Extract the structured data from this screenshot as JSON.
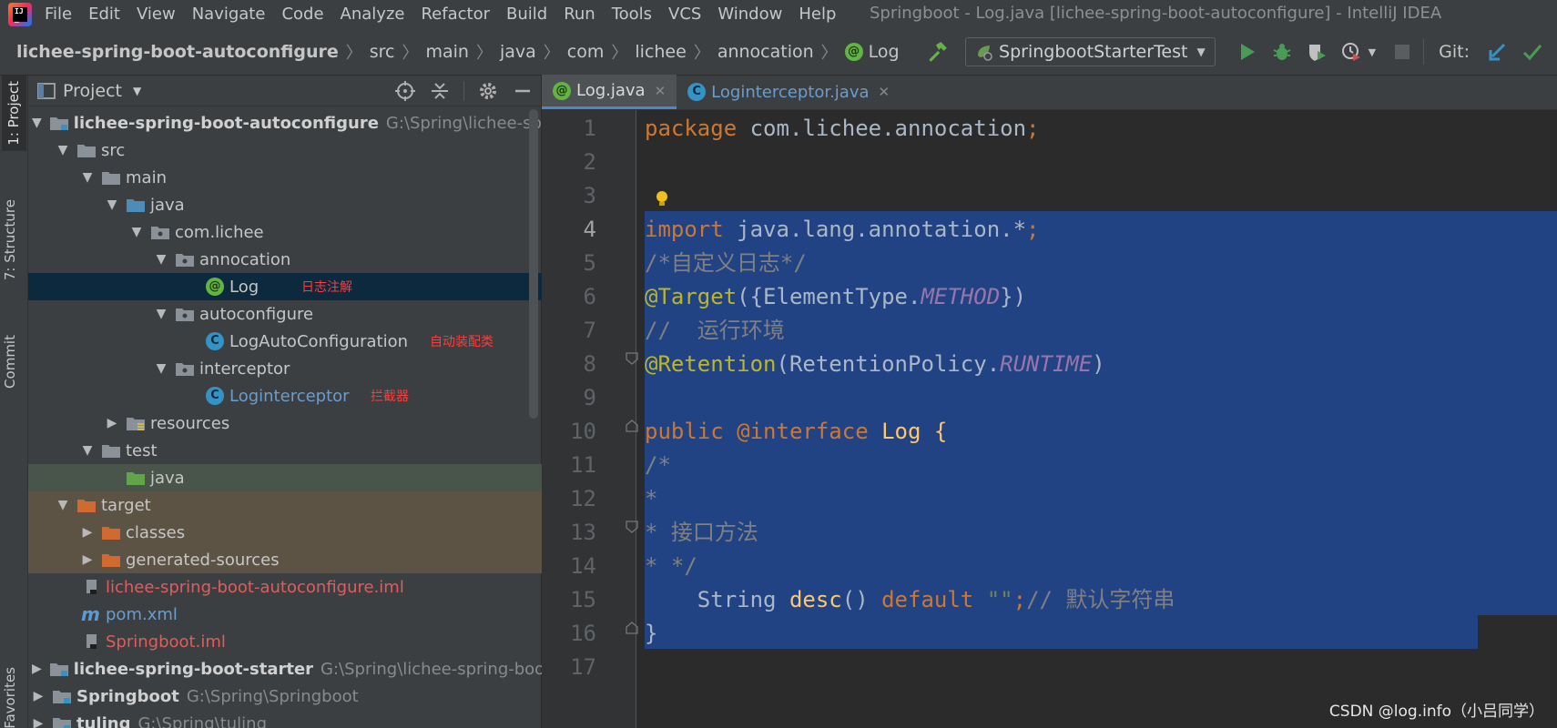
{
  "app": {
    "window_title": "Springboot - Log.java [lichee-spring-boot-autoconfigure] - IntelliJ IDEA",
    "logo": "intellij-logo"
  },
  "menu": {
    "items": [
      {
        "label": "File"
      },
      {
        "label": "Edit"
      },
      {
        "label": "View"
      },
      {
        "label": "Navigate"
      },
      {
        "label": "Code"
      },
      {
        "label": "Analyze"
      },
      {
        "label": "Refactor"
      },
      {
        "label": "Build"
      },
      {
        "label": "Run"
      },
      {
        "label": "Tools"
      },
      {
        "label": "VCS"
      },
      {
        "label": "Window"
      },
      {
        "label": "Help"
      }
    ]
  },
  "breadcrumb": {
    "items": [
      {
        "label": "lichee-spring-boot-autoconfigure"
      },
      {
        "label": "src"
      },
      {
        "label": "main"
      },
      {
        "label": "java"
      },
      {
        "label": "com"
      },
      {
        "label": "lichee"
      },
      {
        "label": "annocation"
      },
      {
        "label": "Log"
      }
    ]
  },
  "toolbar": {
    "run_config": "SpringbootStarterTest",
    "git_label": "Git:"
  },
  "left_strip": {
    "project_tab": "1: Project",
    "structure_tab": "7: Structure",
    "commit_tab": "Commit",
    "favorites_tab": "Favorites"
  },
  "project_panel": {
    "title": "Project",
    "tree": [
      {
        "label": "lichee-spring-boot-autoconfigure",
        "hint": "G:\\Spring\\lichee-sprin"
      },
      {
        "label": "src"
      },
      {
        "label": "main"
      },
      {
        "label": "java"
      },
      {
        "label": "com.lichee"
      },
      {
        "label": "annocation"
      },
      {
        "label": "Log"
      },
      {
        "label": "autoconfigure"
      },
      {
        "label": "LogAutoConfiguration"
      },
      {
        "label": "interceptor"
      },
      {
        "label": "Loginterceptor"
      },
      {
        "label": "resources"
      },
      {
        "label": "test"
      },
      {
        "label": "java"
      },
      {
        "label": "target"
      },
      {
        "label": "classes"
      },
      {
        "label": "generated-sources"
      },
      {
        "label": "lichee-spring-boot-autoconfigure.iml"
      },
      {
        "label": "pom.xml"
      },
      {
        "label": "Springboot.iml"
      },
      {
        "label": "lichee-spring-boot-starter",
        "hint": "G:\\Spring\\lichee-spring-boot-"
      },
      {
        "label": "Springboot",
        "hint": "G:\\Spring\\Springboot"
      },
      {
        "label": "tuling",
        "hint": "G:\\Spring\\tuling"
      }
    ],
    "notes": {
      "log": "日志注解",
      "autoconfig": "自动装配类",
      "interceptor": "拦截器"
    }
  },
  "editor": {
    "tabs": [
      {
        "label": "Log.java",
        "active": true
      },
      {
        "label": "Loginterceptor.java",
        "active": false
      }
    ],
    "line_numbers": [
      "1",
      "2",
      "3",
      "4",
      "5",
      "6",
      "7",
      "8",
      "9",
      "10",
      "11",
      "12",
      "13",
      "14",
      "15",
      "16",
      "17"
    ],
    "code": {
      "l1_kw": "package",
      "l1_rest": " com.lichee.annocation",
      "l1_semi": ";",
      "l4_kw": "import",
      "l4_rest": " java.lang.annotation.*",
      "l4_semi": ";",
      "l5": "/*自定义日志*/",
      "l6_ann": "@Target",
      "l6_a": "({ElementType.",
      "l6_it": "METHOD",
      "l6_b": "})",
      "l7": "//  运行环境",
      "l8_ann": "@Retention",
      "l8_a": "(RetentionPolicy.",
      "l8_it": "RUNTIME",
      "l8_b": ")",
      "l10_kw": "public",
      "l10_ann": " @interface",
      "l10_a": " Log {",
      "l11": "/*",
      "l12": "*",
      "l13": "* 接口方法",
      "l14": "* */",
      "l15_a": "    String ",
      "l15_fn": "desc",
      "l15_b": "() ",
      "l15_kw": "default",
      "l15_str": " \"\"",
      "l15_semi": ";",
      "l15_cm": "// 默认字符串",
      "l16": "}"
    }
  },
  "watermark": "CSDN @log.info（小吕同学）",
  "colors": {
    "accent": "#4a88c7",
    "selection": "#214283",
    "note_red": "#ff3b3b"
  }
}
